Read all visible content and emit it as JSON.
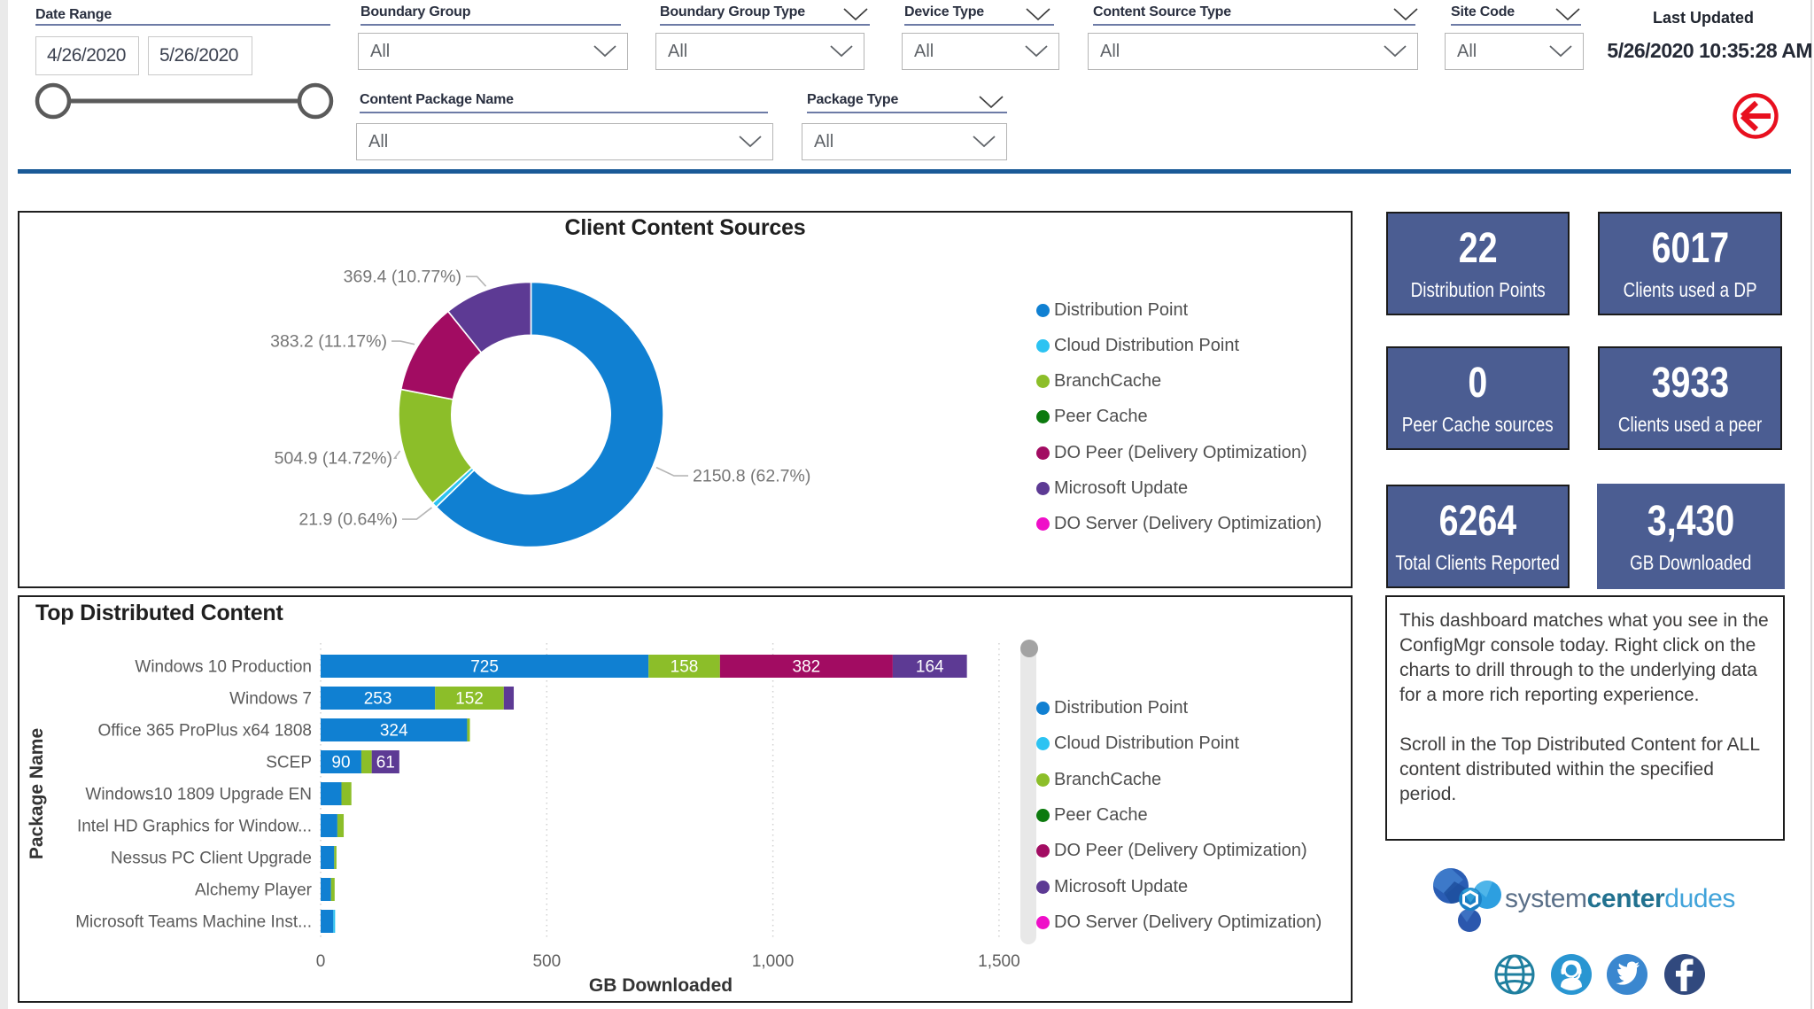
{
  "header": {
    "date_range": {
      "label": "Date Range",
      "start": "4/26/2020",
      "end": "5/26/2020"
    },
    "slicers": [
      {
        "label": "Boundary Group",
        "value": "All"
      },
      {
        "label": "Boundary Group Type",
        "value": "All"
      },
      {
        "label": "Device Type",
        "value": "All"
      },
      {
        "label": "Content Source Type",
        "value": "All"
      },
      {
        "label": "Site Code",
        "value": "All"
      },
      {
        "label": "Content Package Name",
        "value": "All"
      },
      {
        "label": "Package Type",
        "value": "All"
      }
    ],
    "last_updated": {
      "label": "Last Updated",
      "value": "5/26/2020 10:35:28 AM"
    },
    "back_button_icon": "back-arrow-icon",
    "accent_colors": {
      "divider_blue": "#1a5a97",
      "back_red": "#e8101f"
    }
  },
  "legend": [
    {
      "name": "Distribution Point",
      "color": "#1080d2"
    },
    {
      "name": "Cloud Distribution Point",
      "color": "#2cc3f2"
    },
    {
      "name": "BranchCache",
      "color": "#8cbe29"
    },
    {
      "name": "Peer Cache",
      "color": "#0c7a0e"
    },
    {
      "name": "DO Peer (Delivery Optimization)",
      "color": "#a20c62"
    },
    {
      "name": "Microsoft Update",
      "color": "#5d3a94"
    },
    {
      "name": "DO Server (Delivery Optimization)",
      "color": "#ef0fc8"
    }
  ],
  "chart_data": [
    {
      "type": "pie",
      "title": "Client Content Sources",
      "inner_radius_ratio": 0.6,
      "legend_position": "right",
      "slices": [
        {
          "name": "Distribution Point",
          "value": 2150.8,
          "pct": 62.7,
          "label": "2150.8 (62.7%)"
        },
        {
          "name": "Cloud Distribution Point",
          "value": 21.9,
          "pct": 0.64,
          "label": "21.9 (0.64%)"
        },
        {
          "name": "BranchCache",
          "value": 504.9,
          "pct": 14.72,
          "label": "504.9 (14.72%)"
        },
        {
          "name": "DO Peer (Delivery Optimization)",
          "value": 383.2,
          "pct": 11.17,
          "label": "383.2 (11.17%)"
        },
        {
          "name": "Microsoft Update",
          "value": 369.4,
          "pct": 10.77,
          "label": "369.4 (10.77%)"
        }
      ]
    },
    {
      "type": "bar",
      "title": "Top Distributed Content",
      "xlabel": "GB Downloaded",
      "ylabel": "Package Name",
      "xlim": [
        0,
        1520
      ],
      "x_ticks": [
        {
          "value": 0,
          "label": "0"
        },
        {
          "value": 500,
          "label": "500"
        },
        {
          "value": 1000,
          "label": "1,000"
        },
        {
          "value": 1500,
          "label": "1,500"
        }
      ],
      "grid": "dotted",
      "legend_position": "right",
      "categories": [
        "Windows 10 Production",
        "Windows 7",
        "Office 365 ProPlus x64 1808",
        "SCEP",
        "Windows10 1809 Upgrade EN",
        "Intel HD Graphics for Window...",
        "Nessus PC Client Upgrade",
        "Alchemy Player",
        "Microsoft Teams Machine Inst..."
      ],
      "series": [
        {
          "name": "Distribution Point",
          "values": [
            725,
            253,
            324,
            90,
            46,
            37,
            30,
            23,
            28
          ],
          "labels": [
            "725",
            "253",
            "324",
            "90",
            "",
            "",
            "",
            "",
            ""
          ]
        },
        {
          "name": "Cloud Distribution Point",
          "values": [
            0,
            0,
            0,
            0,
            0,
            0,
            0,
            0,
            4
          ],
          "labels": [
            "",
            "",
            "",
            "",
            "",
            "",
            "",
            "",
            ""
          ]
        },
        {
          "name": "BranchCache",
          "values": [
            158,
            152,
            6,
            23,
            22,
            14,
            5,
            8,
            0
          ],
          "labels": [
            "158",
            "152",
            "",
            "",
            "",
            "",
            "",
            "",
            ""
          ]
        },
        {
          "name": "DO Peer (Delivery Optimization)",
          "values": [
            382,
            0,
            0,
            0,
            0,
            0,
            0,
            0,
            0
          ],
          "labels": [
            "382",
            "",
            "",
            "",
            "",
            "",
            "",
            "",
            ""
          ]
        },
        {
          "name": "Microsoft Update",
          "values": [
            164,
            22,
            0,
            61,
            0,
            0,
            0,
            0,
            0
          ],
          "labels": [
            "164",
            "",
            "",
            "61",
            "",
            "",
            "",
            "",
            ""
          ]
        }
      ]
    }
  ],
  "kpis": [
    {
      "value": "22",
      "label": "Distribution Points"
    },
    {
      "value": "6017",
      "label": "Clients used a DP"
    },
    {
      "value": "0",
      "label": "Peer Cache sources"
    },
    {
      "value": "3933",
      "label": "Clients used a peer"
    },
    {
      "value": "6264",
      "label": "Total Clients Reported"
    },
    {
      "value": "3,430",
      "label": "GB Downloaded"
    }
  ],
  "note": {
    "paragraph1": "This dashboard matches what you see in the ConfigMgr console today. Right click on the charts to drill through to the underlying data for a more rich reporting experience.",
    "paragraph2": "Scroll in the Top Distributed Content for ALL content distributed within the specified period."
  },
  "footer": {
    "logo": {
      "part1": "system",
      "part2": "center",
      "part3": "dudes"
    },
    "social_icons": [
      "globe-icon",
      "support-icon",
      "twitter-icon",
      "facebook-icon"
    ]
  }
}
